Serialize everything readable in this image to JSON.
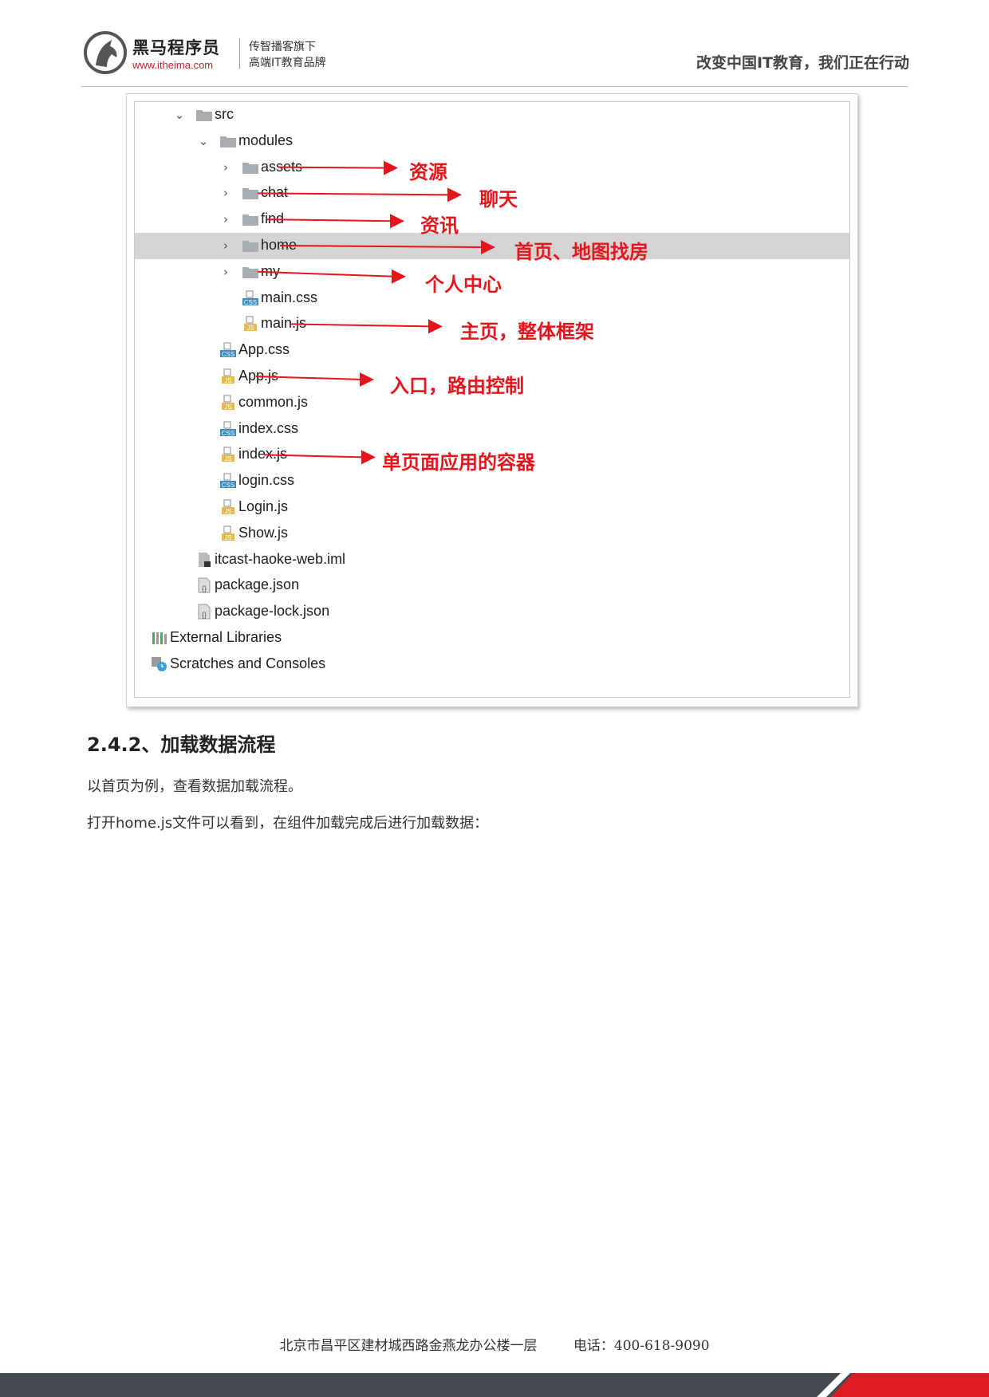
{
  "header": {
    "brand": "黑马程序员",
    "site": "www.itheima.com",
    "tagline1": "传智播客旗下",
    "tagline2": "高端IT教育品牌",
    "slogan": "改变中国IT教育，我们正在行动"
  },
  "tree": {
    "rows": [
      {
        "label": "src",
        "type": "folder",
        "expand": "open"
      },
      {
        "label": "modules",
        "type": "folder",
        "expand": "open"
      },
      {
        "label": "assets",
        "type": "folder",
        "expand": "closed"
      },
      {
        "label": "chat",
        "type": "folder",
        "expand": "closed"
      },
      {
        "label": "find",
        "type": "folder",
        "expand": "closed"
      },
      {
        "label": "home",
        "type": "folder",
        "expand": "closed",
        "selected": true
      },
      {
        "label": "my",
        "type": "folder",
        "expand": "closed"
      },
      {
        "label": "main.css",
        "type": "css"
      },
      {
        "label": "main.js",
        "type": "js"
      },
      {
        "label": "App.css",
        "type": "css"
      },
      {
        "label": "App.js",
        "type": "js"
      },
      {
        "label": "common.js",
        "type": "js"
      },
      {
        "label": "index.css",
        "type": "css"
      },
      {
        "label": "index.js",
        "type": "js"
      },
      {
        "label": "login.css",
        "type": "css"
      },
      {
        "label": "Login.js",
        "type": "js"
      },
      {
        "label": "Show.js",
        "type": "js"
      },
      {
        "label": "itcast-haoke-web.iml",
        "type": "iml"
      },
      {
        "label": "package.json",
        "type": "json"
      },
      {
        "label": "package-lock.json",
        "type": "json"
      },
      {
        "label": "External Libraries",
        "type": "libs"
      },
      {
        "label": "Scratches and Consoles",
        "type": "scratch"
      }
    ],
    "annotations": [
      "资源",
      "聊天",
      "资讯",
      "首页、地图找房",
      "个人中心",
      "主页，整体框架",
      "入口，路由控制",
      "单页面应用的容器"
    ]
  },
  "section": {
    "heading": "2.4.2、加载数据流程",
    "para1": "以首页为例，查看数据加载流程。",
    "para2": "打开home.js文件可以看到，在组件加载完成后进行加载数据："
  },
  "footer": {
    "address": "北京市昌平区建材城西路金燕龙办公楼一层",
    "phone": "电话：400-618-9090"
  },
  "colors": {
    "accent": "#e8141c",
    "brand": "#c8202a",
    "footer_bar": "#444a50"
  }
}
